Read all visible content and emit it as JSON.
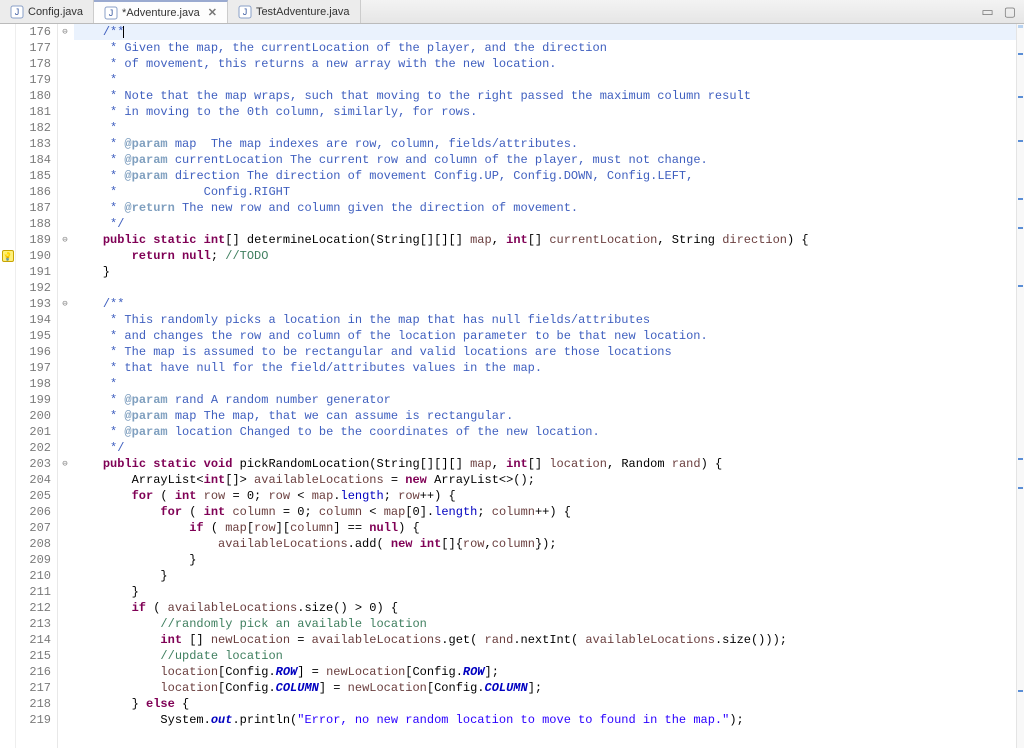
{
  "tabs": [
    {
      "label": "Config.java",
      "active": false
    },
    {
      "label": "*Adventure.java",
      "active": true
    },
    {
      "label": "TestAdventure.java",
      "active": false
    }
  ],
  "lines": [
    {
      "n": "176",
      "fold": "⊖",
      "marker": "",
      "cls": "cur",
      "tokens": [
        [
          "    ",
          ""
        ],
        [
          "/**",
          {
            "c": "c-doc"
          }
        ],
        [
          "|",
          "cursor"
        ]
      ]
    },
    {
      "n": "177",
      "tokens": [
        [
          "     ",
          ""
        ],
        [
          "* Given the map, the currentLocation of the player, and the direction",
          {
            "c": "c-doc"
          }
        ]
      ]
    },
    {
      "n": "178",
      "tokens": [
        [
          "     ",
          ""
        ],
        [
          "* of movement, this returns a new array with the new location.",
          {
            "c": "c-doc"
          }
        ]
      ]
    },
    {
      "n": "179",
      "tokens": [
        [
          "     ",
          ""
        ],
        [
          "*",
          {
            "c": "c-doc"
          }
        ]
      ]
    },
    {
      "n": "180",
      "tokens": [
        [
          "     ",
          ""
        ],
        [
          "* Note that the map wraps, such that moving to the right passed the maximum column result",
          {
            "c": "c-doc"
          }
        ]
      ]
    },
    {
      "n": "181",
      "tokens": [
        [
          "     ",
          ""
        ],
        [
          "* in moving to the 0th column, similarly, for rows.",
          {
            "c": "c-doc"
          }
        ]
      ]
    },
    {
      "n": "182",
      "tokens": [
        [
          "     ",
          ""
        ],
        [
          "*",
          {
            "c": "c-doc"
          }
        ]
      ]
    },
    {
      "n": "183",
      "tokens": [
        [
          "     ",
          ""
        ],
        [
          "* ",
          {
            "c": "c-doc"
          }
        ],
        [
          "@param",
          {
            "c": "c-tag"
          }
        ],
        [
          " map  The map indexes are row, column, fields/attributes.",
          {
            "c": "c-doc"
          }
        ]
      ]
    },
    {
      "n": "184",
      "tokens": [
        [
          "     ",
          ""
        ],
        [
          "* ",
          {
            "c": "c-doc"
          }
        ],
        [
          "@param",
          {
            "c": "c-tag"
          }
        ],
        [
          " currentLocation The current row and column of the player, must not change.",
          {
            "c": "c-doc"
          }
        ]
      ]
    },
    {
      "n": "185",
      "tokens": [
        [
          "     ",
          ""
        ],
        [
          "* ",
          {
            "c": "c-doc"
          }
        ],
        [
          "@param",
          {
            "c": "c-tag"
          }
        ],
        [
          " direction The direction of movement Config.UP, Config.DOWN, Config.LEFT,",
          {
            "c": "c-doc"
          }
        ]
      ]
    },
    {
      "n": "186",
      "tokens": [
        [
          "     ",
          ""
        ],
        [
          "*            Config.RIGHT",
          {
            "c": "c-doc"
          }
        ]
      ]
    },
    {
      "n": "187",
      "tokens": [
        [
          "     ",
          ""
        ],
        [
          "* ",
          {
            "c": "c-doc"
          }
        ],
        [
          "@return",
          {
            "c": "c-tag"
          }
        ],
        [
          " The new row and column given the direction of movement.",
          {
            "c": "c-doc"
          }
        ]
      ]
    },
    {
      "n": "188",
      "tokens": [
        [
          "     ",
          ""
        ],
        [
          "*/",
          {
            "c": "c-doc"
          }
        ]
      ]
    },
    {
      "n": "189",
      "fold": "⊖",
      "tokens": [
        [
          "    ",
          ""
        ],
        [
          "public",
          {
            "c": "c-kw"
          }
        ],
        [
          " ",
          ""
        ],
        [
          "static",
          {
            "c": "c-kw"
          }
        ],
        [
          " ",
          ""
        ],
        [
          "int",
          {
            "c": "c-kw"
          }
        ],
        [
          "[] determineLocation(String[][][] ",
          ""
        ],
        [
          "map",
          {
            "c": "c-par"
          }
        ],
        [
          ", ",
          ""
        ],
        [
          "int",
          {
            "c": "c-kw"
          }
        ],
        [
          "[] ",
          ""
        ],
        [
          "currentLocation",
          {
            "c": "c-par"
          }
        ],
        [
          ", String ",
          ""
        ],
        [
          "direction",
          {
            "c": "c-par"
          }
        ],
        [
          ") {",
          ""
        ]
      ]
    },
    {
      "n": "190",
      "marker": "qfix",
      "tokens": [
        [
          "        ",
          ""
        ],
        [
          "return",
          {
            "c": "c-kw"
          }
        ],
        [
          " ",
          ""
        ],
        [
          "null",
          {
            "c": "c-kw"
          }
        ],
        [
          "; ",
          ""
        ],
        [
          "//TODO",
          {
            "c": "c-com"
          }
        ]
      ]
    },
    {
      "n": "191",
      "tokens": [
        [
          "    }",
          ""
        ]
      ]
    },
    {
      "n": "192",
      "tokens": [
        [
          "",
          ""
        ]
      ]
    },
    {
      "n": "193",
      "fold": "⊖",
      "tokens": [
        [
          "    ",
          ""
        ],
        [
          "/**",
          {
            "c": "c-doc"
          }
        ]
      ]
    },
    {
      "n": "194",
      "tokens": [
        [
          "     ",
          ""
        ],
        [
          "* This randomly picks a location in the map that has null fields/attributes",
          {
            "c": "c-doc"
          }
        ]
      ]
    },
    {
      "n": "195",
      "tokens": [
        [
          "     ",
          ""
        ],
        [
          "* and changes the row and column of the location parameter to be that new location.",
          {
            "c": "c-doc"
          }
        ]
      ]
    },
    {
      "n": "196",
      "tokens": [
        [
          "     ",
          ""
        ],
        [
          "* The map is assumed to be rectangular and valid locations are those locations",
          {
            "c": "c-doc"
          }
        ]
      ]
    },
    {
      "n": "197",
      "tokens": [
        [
          "     ",
          ""
        ],
        [
          "* that have null for the field/attributes values in the map.",
          {
            "c": "c-doc"
          }
        ]
      ]
    },
    {
      "n": "198",
      "tokens": [
        [
          "     ",
          ""
        ],
        [
          "*",
          {
            "c": "c-doc"
          }
        ]
      ]
    },
    {
      "n": "199",
      "tokens": [
        [
          "     ",
          ""
        ],
        [
          "* ",
          {
            "c": "c-doc"
          }
        ],
        [
          "@param",
          {
            "c": "c-tag"
          }
        ],
        [
          " rand A random number generator",
          {
            "c": "c-doc"
          }
        ]
      ]
    },
    {
      "n": "200",
      "tokens": [
        [
          "     ",
          ""
        ],
        [
          "* ",
          {
            "c": "c-doc"
          }
        ],
        [
          "@param",
          {
            "c": "c-tag"
          }
        ],
        [
          " map The map, that we can assume is rectangular.",
          {
            "c": "c-doc"
          }
        ]
      ]
    },
    {
      "n": "201",
      "tokens": [
        [
          "     ",
          ""
        ],
        [
          "* ",
          {
            "c": "c-doc"
          }
        ],
        [
          "@param",
          {
            "c": "c-tag"
          }
        ],
        [
          " location Changed to be the coordinates of the new location.",
          {
            "c": "c-doc"
          }
        ]
      ]
    },
    {
      "n": "202",
      "tokens": [
        [
          "     ",
          ""
        ],
        [
          "*/",
          {
            "c": "c-doc"
          }
        ]
      ]
    },
    {
      "n": "203",
      "fold": "⊖",
      "tokens": [
        [
          "    ",
          ""
        ],
        [
          "public",
          {
            "c": "c-kw"
          }
        ],
        [
          " ",
          ""
        ],
        [
          "static",
          {
            "c": "c-kw"
          }
        ],
        [
          " ",
          ""
        ],
        [
          "void",
          {
            "c": "c-kw"
          }
        ],
        [
          " pickRandomLocation(String[][][] ",
          ""
        ],
        [
          "map",
          {
            "c": "c-par"
          }
        ],
        [
          ", ",
          ""
        ],
        [
          "int",
          {
            "c": "c-kw"
          }
        ],
        [
          "[] ",
          ""
        ],
        [
          "location",
          {
            "c": "c-par"
          }
        ],
        [
          ", Random ",
          ""
        ],
        [
          "rand",
          {
            "c": "c-par"
          }
        ],
        [
          ") {",
          ""
        ]
      ]
    },
    {
      "n": "204",
      "tokens": [
        [
          "        ArrayList<",
          ""
        ],
        [
          "int",
          {
            "c": "c-kw"
          }
        ],
        [
          "[]> ",
          ""
        ],
        [
          "availableLocations",
          {
            "c": "c-par"
          }
        ],
        [
          " = ",
          ""
        ],
        [
          "new",
          {
            "c": "c-kw"
          }
        ],
        [
          " ArrayList<>();",
          ""
        ]
      ]
    },
    {
      "n": "205",
      "tokens": [
        [
          "        ",
          ""
        ],
        [
          "for",
          {
            "c": "c-kw"
          }
        ],
        [
          " ( ",
          ""
        ],
        [
          "int",
          {
            "c": "c-kw"
          }
        ],
        [
          " ",
          ""
        ],
        [
          "row",
          {
            "c": "c-par"
          }
        ],
        [
          " = 0; ",
          ""
        ],
        [
          "row",
          {
            "c": "c-par"
          }
        ],
        [
          " < ",
          ""
        ],
        [
          "map",
          {
            "c": "c-par"
          }
        ],
        [
          ".",
          ""
        ],
        [
          "length",
          {
            "c": "c-fld"
          }
        ],
        [
          "; ",
          ""
        ],
        [
          "row",
          {
            "c": "c-par"
          }
        ],
        [
          "++) {",
          ""
        ]
      ]
    },
    {
      "n": "206",
      "tokens": [
        [
          "            ",
          ""
        ],
        [
          "for",
          {
            "c": "c-kw"
          }
        ],
        [
          " ( ",
          ""
        ],
        [
          "int",
          {
            "c": "c-kw"
          }
        ],
        [
          " ",
          ""
        ],
        [
          "column",
          {
            "c": "c-par"
          }
        ],
        [
          " = 0; ",
          ""
        ],
        [
          "column",
          {
            "c": "c-par"
          }
        ],
        [
          " < ",
          ""
        ],
        [
          "map",
          {
            "c": "c-par"
          }
        ],
        [
          "[0].",
          ""
        ],
        [
          "length",
          {
            "c": "c-fld"
          }
        ],
        [
          "; ",
          ""
        ],
        [
          "column",
          {
            "c": "c-par"
          }
        ],
        [
          "++) {",
          ""
        ]
      ]
    },
    {
      "n": "207",
      "tokens": [
        [
          "                ",
          ""
        ],
        [
          "if",
          {
            "c": "c-kw"
          }
        ],
        [
          " ( ",
          ""
        ],
        [
          "map",
          {
            "c": "c-par"
          }
        ],
        [
          "[",
          ""
        ],
        [
          "row",
          {
            "c": "c-par"
          }
        ],
        [
          "][",
          ""
        ],
        [
          "column",
          {
            "c": "c-par"
          }
        ],
        [
          "] == ",
          ""
        ],
        [
          "null",
          {
            "c": "c-kw"
          }
        ],
        [
          ") {",
          ""
        ]
      ]
    },
    {
      "n": "208",
      "tokens": [
        [
          "                    ",
          ""
        ],
        [
          "availableLocations",
          {
            "c": "c-par"
          }
        ],
        [
          ".add( ",
          ""
        ],
        [
          "new",
          {
            "c": "c-kw"
          }
        ],
        [
          " ",
          ""
        ],
        [
          "int",
          {
            "c": "c-kw"
          }
        ],
        [
          "[]{",
          ""
        ],
        [
          "row",
          {
            "c": "c-par"
          }
        ],
        [
          ",",
          ""
        ],
        [
          "column",
          {
            "c": "c-par"
          }
        ],
        [
          "});",
          ""
        ]
      ]
    },
    {
      "n": "209",
      "tokens": [
        [
          "                }",
          ""
        ]
      ]
    },
    {
      "n": "210",
      "tokens": [
        [
          "            }",
          ""
        ]
      ]
    },
    {
      "n": "211",
      "tokens": [
        [
          "        }",
          ""
        ]
      ]
    },
    {
      "n": "212",
      "tokens": [
        [
          "        ",
          ""
        ],
        [
          "if",
          {
            "c": "c-kw"
          }
        ],
        [
          " ( ",
          ""
        ],
        [
          "availableLocations",
          {
            "c": "c-par"
          }
        ],
        [
          ".size() > 0) {",
          ""
        ]
      ]
    },
    {
      "n": "213",
      "tokens": [
        [
          "            ",
          ""
        ],
        [
          "//randomly pick an available location",
          {
            "c": "c-com"
          }
        ]
      ]
    },
    {
      "n": "214",
      "tokens": [
        [
          "            ",
          ""
        ],
        [
          "int",
          {
            "c": "c-kw"
          }
        ],
        [
          " [] ",
          ""
        ],
        [
          "newLocation",
          {
            "c": "c-par"
          }
        ],
        [
          " = ",
          ""
        ],
        [
          "availableLocations",
          {
            "c": "c-par"
          }
        ],
        [
          ".get( ",
          ""
        ],
        [
          "rand",
          {
            "c": "c-par"
          }
        ],
        [
          ".nextInt( ",
          ""
        ],
        [
          "availableLocations",
          {
            "c": "c-par"
          }
        ],
        [
          ".size()));",
          ""
        ]
      ]
    },
    {
      "n": "215",
      "tokens": [
        [
          "            ",
          ""
        ],
        [
          "//update location",
          {
            "c": "c-com"
          }
        ]
      ]
    },
    {
      "n": "216",
      "tokens": [
        [
          "            ",
          ""
        ],
        [
          "location",
          {
            "c": "c-par"
          }
        ],
        [
          "[Config.",
          ""
        ],
        [
          "ROW",
          {
            "c": "c-sfld"
          }
        ],
        [
          "] = ",
          ""
        ],
        [
          "newLocation",
          {
            "c": "c-par"
          }
        ],
        [
          "[Config.",
          ""
        ],
        [
          "ROW",
          {
            "c": "c-sfld"
          }
        ],
        [
          "];",
          ""
        ]
      ]
    },
    {
      "n": "217",
      "tokens": [
        [
          "            ",
          ""
        ],
        [
          "location",
          {
            "c": "c-par"
          }
        ],
        [
          "[Config.",
          ""
        ],
        [
          "COLUMN",
          {
            "c": "c-sfld"
          }
        ],
        [
          "] = ",
          ""
        ],
        [
          "newLocation",
          {
            "c": "c-par"
          }
        ],
        [
          "[Config.",
          ""
        ],
        [
          "COLUMN",
          {
            "c": "c-sfld"
          }
        ],
        [
          "];",
          ""
        ]
      ]
    },
    {
      "n": "218",
      "tokens": [
        [
          "        } ",
          ""
        ],
        [
          "else",
          {
            "c": "c-kw"
          }
        ],
        [
          " {",
          ""
        ]
      ]
    },
    {
      "n": "219",
      "tokens": [
        [
          "            System.",
          ""
        ],
        [
          "out",
          {
            "c": "c-sfld"
          }
        ],
        [
          ".println(",
          ""
        ],
        [
          "\"Error, no new random location to move to found in the map.\"",
          {
            "c": "c-str"
          }
        ],
        [
          ");",
          ""
        ]
      ]
    }
  ],
  "overview_ticks": [
    4,
    10,
    16,
    24,
    28,
    36,
    60,
    64,
    92
  ]
}
